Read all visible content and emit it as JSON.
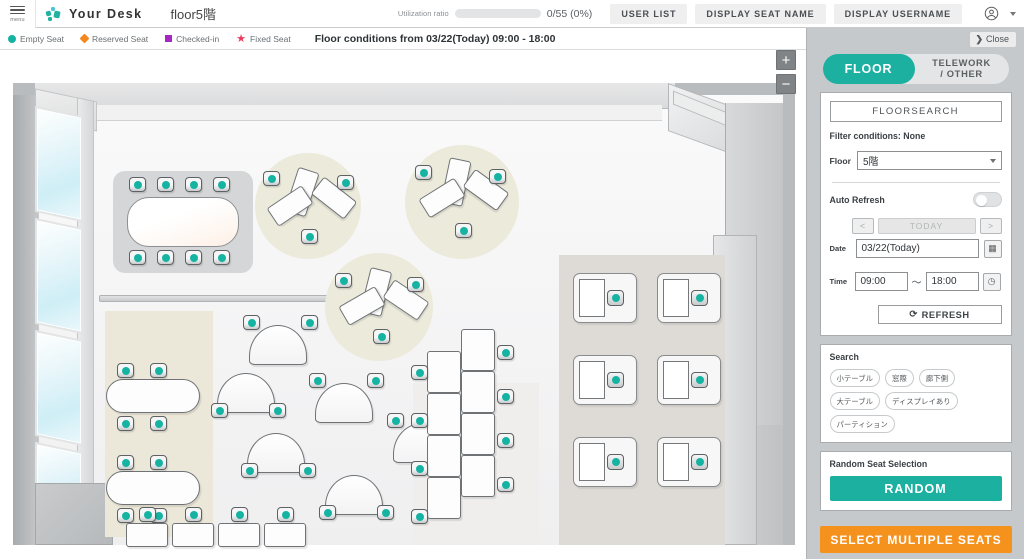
{
  "topbar": {
    "menu_label": "menu",
    "brand": "Your Desk",
    "floor_title": "floor5階",
    "utilization_label": "Utilization ratio",
    "utilization_value": "0/55 (0%)",
    "utilization_percent": 0,
    "buttons": [
      {
        "label": "USER LIST",
        "name": "user-list-button"
      },
      {
        "label": "DISPLAY SEAT NAME",
        "name": "display-seat-name-button"
      },
      {
        "label": "DISPLAY USERNAME",
        "name": "display-username-button"
      }
    ]
  },
  "legend": {
    "items": [
      {
        "label": "Empty Seat",
        "marker": "circle",
        "color": "#16b3a3"
      },
      {
        "label": "Reserved Seat",
        "marker": "diamond",
        "color": "#f5871f"
      },
      {
        "label": "Checked-in",
        "marker": "square",
        "color": "#a627c2"
      },
      {
        "label": "Fixed Seat",
        "marker": "star",
        "color": "#ef3b5b"
      }
    ],
    "conditions": "Floor conditions from 03/22(Today) 09:00 - 18:00"
  },
  "map": {
    "zoom_in": "+",
    "zoom_out": "−"
  },
  "panel": {
    "close_label": "Close",
    "close_chevron": "❯",
    "tabs": {
      "floor": "FLOOR",
      "telework": "TELEWORK\n/ OTHER",
      "telework_line1": "TELEWORK",
      "telework_line2": "/ OTHER",
      "active": "FLOOR"
    },
    "floorsearch_button": "FLOORSEARCH",
    "filter_conditions": "Filter conditions: None",
    "floor_field": {
      "label": "Floor",
      "value": "5階",
      "options": [
        "5階"
      ]
    },
    "auto_refresh": {
      "label": "Auto Refresh",
      "enabled": false
    },
    "date_nav": {
      "prev": "<",
      "today": "TODAY",
      "next": ">"
    },
    "date_field": {
      "label": "Date",
      "value": "03/22(Today)",
      "calendar_icon": "▦"
    },
    "time_field": {
      "label": "Time",
      "start": "09:00",
      "separator": "～",
      "end": "18:00",
      "clock_icon": "◷",
      "start_options": [
        "09:00"
      ],
      "end_options": [
        "18:00"
      ]
    },
    "refresh_button": {
      "label": "REFRESH",
      "icon": "⟳"
    },
    "search": {
      "label": "Search",
      "tags": [
        "小テーブル",
        "窓際",
        "廊下側",
        "大テーブル",
        "ディスプレイあり",
        "パーティション"
      ]
    },
    "random": {
      "label": "Random Seat Selection",
      "button": "RANDOM"
    },
    "select_multiple_button": "SELECT MULTIPLE SEATS"
  },
  "colors": {
    "accent_teal": "#1bb0a0",
    "accent_orange": "#f5921e",
    "seat_empty": "#16b3a3",
    "panel_bg": "#c6c9cb"
  }
}
